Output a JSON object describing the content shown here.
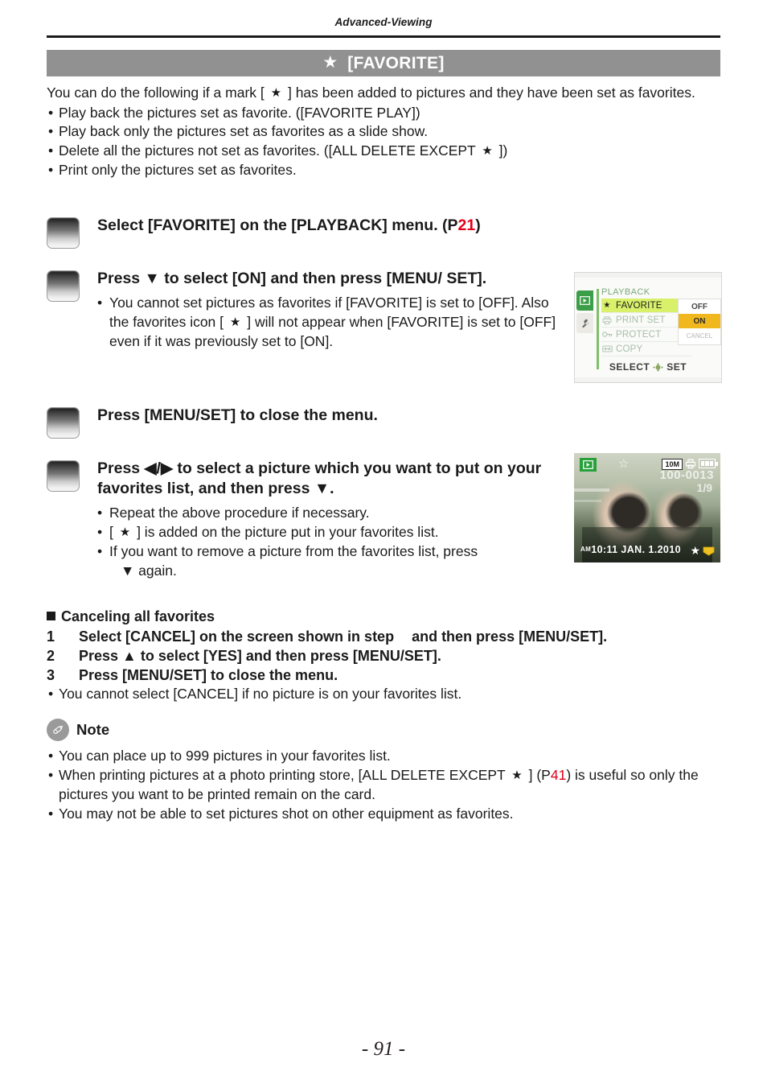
{
  "running_head": "Advanced-Viewing",
  "title": {
    "star_icon": "star-icon",
    "text": "[FAVORITE]"
  },
  "intro": {
    "line1_a": "You can do the following if a mark [",
    "line1_star": "★",
    "line1_b": "] has been added to pictures and they have been set as favorites.",
    "bullets": [
      "Play back the pictures set as favorite. ([FAVORITE PLAY])",
      "Play back only the pictures set as favorites as a slide show."
    ],
    "bullet3_a": "Delete all the pictures not set as favorites. ([ALL DELETE EXCEPT",
    "bullet3_star": "★",
    "bullet3_b": "])",
    "bullet4": "Print only the pictures set as favorites."
  },
  "steps": [
    {
      "title_a": "Select [FAVORITE] on the [PLAYBACK] menu. (P",
      "page_ref": "21",
      "title_b": ")"
    },
    {
      "title": "Press ▼ to select [ON] and then press [MENU/ SET].",
      "bullets": [
        {
          "a": "You cannot set pictures as favorites if [FAVORITE] is set to [OFF]. Also the favorites icon [",
          "star": "★",
          "b": "] will not appear when [FAVORITE] is set to [OFF] even if it was previously set to [ON]."
        }
      ]
    },
    {
      "title": "Press [MENU/SET] to close the menu."
    },
    {
      "title": "Press ◀/▶ to select a picture which you want to put on your favorites list, and then press ▼.",
      "bullets": [
        {
          "text": "Repeat the above procedure if necessary."
        },
        {
          "a": "[",
          "star": "★",
          "b": "] is added on the picture put in your favorites list."
        },
        {
          "text": "If you want to remove a picture from the favorites list, press",
          "cont": "▼ again."
        }
      ]
    }
  ],
  "cancel_section": {
    "heading": "Canceling all favorites",
    "items": [
      {
        "num": "1",
        "text_a": "Select [CANCEL] on the screen shown in step",
        "text_b": "and then press [MENU/SET]."
      },
      {
        "num": "2",
        "text_a": "Press ▲ to select [YES] and then press [MENU/SET].",
        "text_b": ""
      },
      {
        "num": "3",
        "text_a": "Press [MENU/SET] to close the menu.",
        "text_b": ""
      }
    ],
    "bullet": "You cannot select [CANCEL] if no picture is on your favorites list."
  },
  "note": {
    "icon": "pencil-icon",
    "label": "Note",
    "bullets": [
      {
        "text": "You can place up to 999 pictures in your favorites list."
      },
      {
        "a": "When printing pictures at a photo printing store, [ALL DELETE EXCEPT",
        "star": "★",
        "b": "] (P",
        "page_ref": "41",
        "c": ") is useful so only the pictures you want to be printed remain on the card."
      },
      {
        "text": "You may not be able to set pictures shot on other equipment as favorites."
      }
    ]
  },
  "lcd_menu": {
    "tabs": [
      {
        "name": "playback-tab",
        "glyph": "play-icon"
      },
      {
        "name": "setup-tab",
        "glyph": "wrench-icon"
      }
    ],
    "menu_title": "PLAYBACK",
    "rows": [
      {
        "icon": "star-icon",
        "label": "FAVORITE",
        "selected": true
      },
      {
        "icon": "print-icon",
        "label": "PRINT SET",
        "selected": false
      },
      {
        "icon": "key-icon",
        "label": "PROTECT",
        "selected": false
      },
      {
        "icon": "copy-icon",
        "label": "COPY",
        "selected": false
      }
    ],
    "options": [
      {
        "label": "OFF",
        "state": "normal"
      },
      {
        "label": "ON",
        "state": "highlighted"
      },
      {
        "label": "CANCEL",
        "state": "dim"
      }
    ],
    "footer_select": "SELECT",
    "footer_set": "SET"
  },
  "lcd_photo": {
    "play_icon": "play-icon",
    "top_star_icon": "star-outline-icon",
    "resolution": "10M",
    "print_icon": "print-icon",
    "battery_icon": "battery-icon",
    "file_number": "100-0013",
    "frame_count": "1/9",
    "ampm": "AM",
    "datetime": "10:11  JAN.  1.2010",
    "fav_star_icon": "star-icon",
    "fav_tag_icon": "favorite-tag-icon"
  },
  "page_number": "- 91 -",
  "colors": {
    "title_bar": "#919191",
    "page_ref": "#e2001a",
    "menu_highlight": "#d9f06a",
    "option_highlight": "#f0b81e",
    "playback_tab": "#3d9e49"
  }
}
